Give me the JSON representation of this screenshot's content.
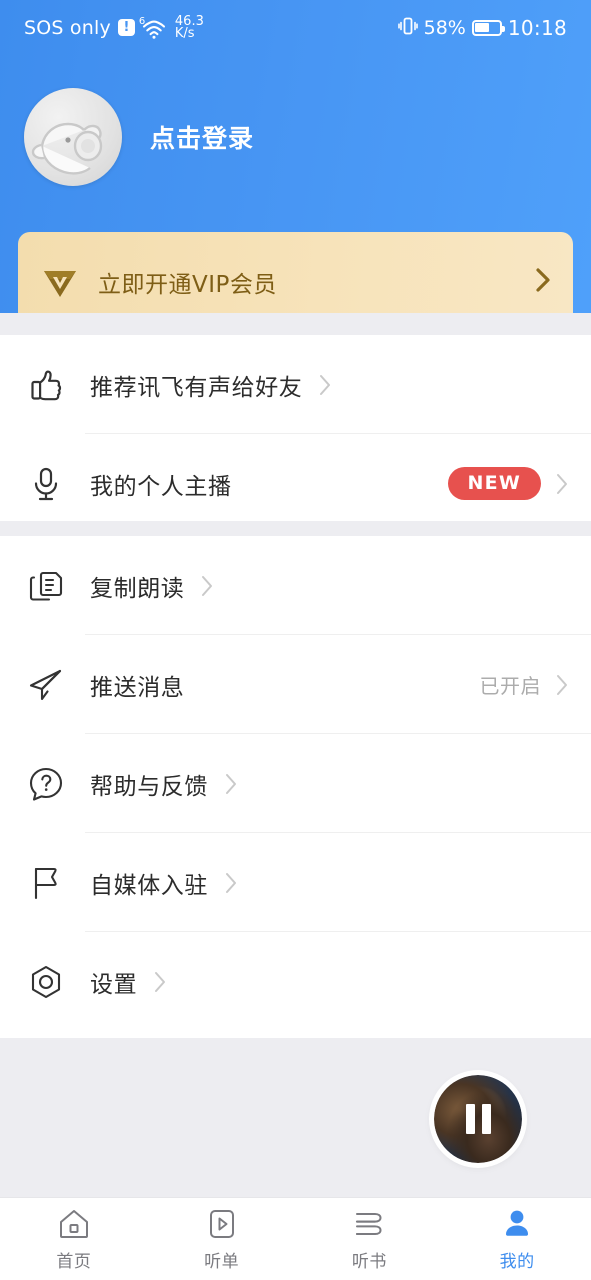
{
  "status_bar": {
    "carrier": "SOS only",
    "warning_icon": "warning-exclamation-icon",
    "wifi_icon": "wifi-icon",
    "wifi_generation": "6",
    "network_speed": "46.3",
    "network_speed_unit": "K/s",
    "vibrate_icon": "vibrate-icon",
    "battery_percent": "58%",
    "battery_level": 58,
    "battery_icon": "battery-icon",
    "time": "10:18"
  },
  "header": {
    "avatar_name": "default-bird-avatar",
    "login_label": "点击登录",
    "background_color": "#4795F3"
  },
  "vip_banner": {
    "icon": "vip-diamond-icon",
    "label": "立即开通VIP会员",
    "chevron": "chevron-right-icon",
    "accent_color": "#7E5E16",
    "background_color": "#F5E0B4"
  },
  "groups": [
    {
      "name": "social-group",
      "rows": [
        {
          "icon": "thumbs-up-icon",
          "label": "推荐讯飞有声给好友",
          "value": "",
          "badge": ""
        },
        {
          "icon": "microphone-icon",
          "label": "我的个人主播",
          "value": "",
          "badge": "NEW"
        }
      ]
    },
    {
      "name": "settings-group",
      "rows": [
        {
          "icon": "copy-document-icon",
          "label": "复制朗读",
          "value": "",
          "badge": ""
        },
        {
          "icon": "paper-plane-icon",
          "label": "推送消息",
          "value": "已开启",
          "badge": ""
        },
        {
          "icon": "question-help-icon",
          "label": "帮助与反馈",
          "value": "",
          "badge": ""
        },
        {
          "icon": "flag-icon",
          "label": "自媒体入驻",
          "value": "",
          "badge": ""
        },
        {
          "icon": "settings-hexagon-icon",
          "label": "设置",
          "value": "",
          "badge": ""
        }
      ]
    }
  ],
  "mini_player": {
    "name": "floating-mini-player",
    "state_icon": "pause-icon",
    "artwork": "album-artwork"
  },
  "bottom_nav": {
    "active_color": "#3E8DEE",
    "inactive_color": "#7B7B80",
    "items": [
      {
        "icon": "home-icon",
        "label": "首页",
        "active": false
      },
      {
        "icon": "playlist-play-icon",
        "label": "听单",
        "active": false
      },
      {
        "icon": "book-icon",
        "label": "听书",
        "active": false
      },
      {
        "icon": "person-icon",
        "label": "我的",
        "active": true
      }
    ]
  },
  "badge_colors": {
    "new_badge": "#E7514E"
  }
}
